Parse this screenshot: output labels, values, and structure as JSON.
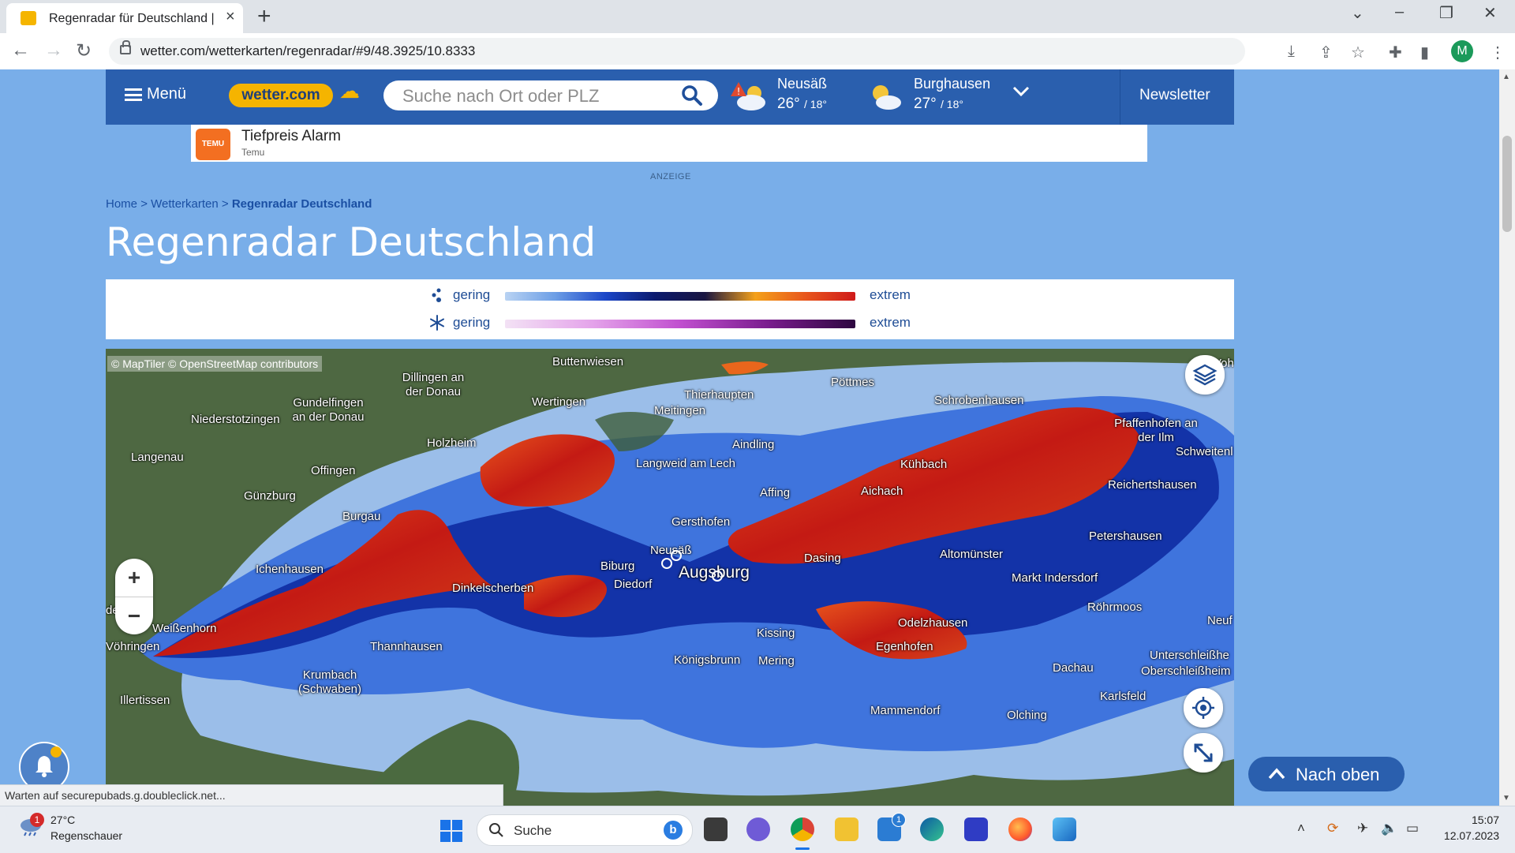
{
  "browser": {
    "tab_title": "Regenradar für Deutschland | wetter.com",
    "url": "wetter.com/wetterkarten/regenradar/#9/48.3925/10.8333",
    "profile_initial": "M"
  },
  "header": {
    "menu_label": "Menü",
    "logo": "wetter.com",
    "search_placeholder": "Suche nach Ort oder PLZ",
    "locations": [
      {
        "name": "Neusäß",
        "high": "26°",
        "low": "/ 18°"
      },
      {
        "name": "Burghausen",
        "high": "27°",
        "low": "/ 18°"
      }
    ],
    "newsletter_label": "Newsletter"
  },
  "ad": {
    "icon_text": "TEMU",
    "title": "Tiefpreis Alarm",
    "subtitle": "Temu",
    "label": "ANZEIGE"
  },
  "breadcrumb": {
    "home": "Home",
    "sep": ">",
    "wetterkarten": "Wetterkarten",
    "current": "Regenradar Deutschland"
  },
  "page_title": "Regenradar Deutschland",
  "legend": {
    "rain": {
      "low": "gering",
      "high": "extrem"
    },
    "snow": {
      "low": "gering",
      "high": "extrem"
    }
  },
  "map": {
    "attribution": "© MapTiler © OpenStreetMap contributors",
    "cities": {
      "buttenwiesen": "Buttenwiesen",
      "dillingen": "Dillingen an der Donau",
      "gundelfingen": "Gundelfingen an der Donau",
      "niederstotzingen": "Niederstotzingen",
      "langenau": "Langenau",
      "wertingen": "Wertingen",
      "thierhaupten": "Thierhaupten",
      "meitingen": "Meitingen",
      "poettmes": "Pöttmes",
      "schrobenhausen": "Schrobenhausen",
      "pfaffenhofen": "Pfaffenhofen an der Ilm",
      "schweitenkirchen": "Schweitenl",
      "vohburg": "Voh",
      "holzheim": "Holzheim",
      "aindling": "Aindling",
      "langweid": "Langweid am Lech",
      "kuehbach": "Kühbach",
      "offingen": "Offingen",
      "guenzburg": "Günzburg",
      "burgau": "Burgau",
      "affing": "Affing",
      "aichach": "Aichach",
      "reichertshausen": "Reichertshausen",
      "gersthofen": "Gersthofen",
      "petershausen": "Petershausen",
      "neusaess": "Neusäß",
      "biburg": "Biburg",
      "diedorf": "Diedorf",
      "augsburg": "Augsburg",
      "dasing": "Dasing",
      "altomuenster": "Altomünster",
      "ichenhausen": "Ichenhausen",
      "dinkelscherben": "Dinkelscherben",
      "markt_indersdorf": "Markt Indersdorf",
      "roehrmoos": "Röhrmoos",
      "leipheim": "den",
      "weissenhorn": "Weißenhorn",
      "odelzhausen": "Odelzhausen",
      "neufahrn": "Neuf",
      "voehringen": "Vöhringen",
      "thannhausen": "Thannhausen",
      "kissing": "Kissing",
      "egenhofen": "Egenhofen",
      "unterschleissheim": "Unterschleißhe",
      "koenigsbrunn": "Königsbrunn",
      "mering": "Mering",
      "dachau": "Dachau",
      "oberschleissheim": "Oberschleißheim",
      "krumbach": "Krumbach (Schwaben)",
      "karlsfeld": "Karlsfeld",
      "illertissen": "Illertissen",
      "mammendorf": "Mammendorf",
      "olching": "Olching"
    }
  },
  "nach_oben_label": "Nach oben",
  "status_bar": "Warten auf securepubads.g.doubleclick.net...",
  "taskbar": {
    "notification_count": "1",
    "temperature": "27°C",
    "condition": "Regenschauer",
    "search_label": "Suche",
    "store_badge": "1",
    "time": "15:07",
    "date": "12.07.2023"
  },
  "colors": {
    "page_bg": "#79aee9",
    "header_bg": "#2a5fae",
    "logo_bg": "#f5b400",
    "title": "#ffffff"
  }
}
